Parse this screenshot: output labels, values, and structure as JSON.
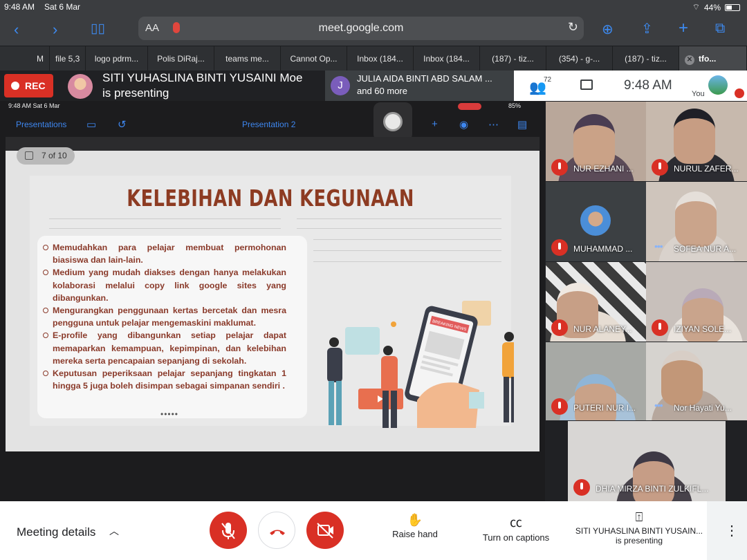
{
  "status_bar": {
    "time": "9:48 AM",
    "date": "Sat 6 Mar",
    "battery": "44%"
  },
  "browser": {
    "text_size_label": "AA",
    "url": "meet.google.com",
    "tabs": [
      {
        "label": "M"
      },
      {
        "label": "file 5,3"
      },
      {
        "label": "logo pdrm..."
      },
      {
        "label": "Polis DiRaj..."
      },
      {
        "label": "teams me..."
      },
      {
        "label": "Cannot Op..."
      },
      {
        "label": "Inbox (184..."
      },
      {
        "label": "Inbox (184..."
      },
      {
        "label": "(187) - tiz..."
      },
      {
        "label": "(354) - g-..."
      },
      {
        "label": "(187) - tiz..."
      },
      {
        "label": "tfo..."
      }
    ]
  },
  "meet_header": {
    "rec_label": "REC",
    "presenter_name": "SITI YUHASLINA BINTI YUSAINI Moe",
    "presenter_status": "is presenting",
    "participant_card": {
      "initial": "J",
      "name": "JULIA AIDA BINTI ABD SALAM ...",
      "more": "and 60 more"
    },
    "people_count": "72",
    "clock": "9:48 AM",
    "you_label": "You"
  },
  "shared_screen": {
    "status_time": "9:48 AM  Sat 6 Mar",
    "battery": "85%",
    "nav_back": "Presentations",
    "doc_title": "Presentation 2",
    "page_indicator": "7 of 10",
    "slide_title": "KELEBIHAN DAN KEGUNAAN",
    "bullets": [
      "Memudahkan para pelajar membuat permohonan biasiswa dan lain-lain.",
      "Medium yang mudah diakses dengan hanya melakukan kolaborasi melalui copy link google sites yang dibangunkan.",
      "Mengurangkan penggunaan kertas bercetak dan mesra pengguna untuk pelajar mengemaskini maklumat.",
      "E-profile yang dibangunkan setiap pelajar dapat memaparkan kemampuan, kepimpinan, dan kelebihan mereka serta pencapaian sepanjang di sekolah.",
      "Keputusan peperiksaan pelajar sepanjang tingkatan 1 hingga 5 juga boleh disimpan sebagai simpanan sendiri ."
    ],
    "slide_dots": "•••••",
    "illustration_news": "BREAKING NEWS"
  },
  "participants": [
    {
      "name": "NUR EZHANI ...",
      "mic": "muted"
    },
    {
      "name": "NURUL ZAFER...",
      "mic": "muted"
    },
    {
      "name": "MUHAMMAD ...",
      "mic": "muted"
    },
    {
      "name": "SOFEA NUR A...",
      "mic": "speaking"
    },
    {
      "name": "NUR ALANEY...",
      "mic": "muted"
    },
    {
      "name": "IZIYAN SOLE...",
      "mic": "muted"
    },
    {
      "name": "PUTERI NUR I...",
      "mic": "muted"
    },
    {
      "name": "Nor Hayati Yu...",
      "mic": "speaking"
    },
    {
      "name": "DHIA MIRZA BINTI ZULKIFL...",
      "mic": "muted"
    }
  ],
  "bottom_bar": {
    "meeting_details": "Meeting details",
    "raise_hand": "Raise hand",
    "captions": "Turn on captions",
    "presenting_name": "SITI YUHASLINA BINTI YUSAIN...",
    "presenting_status": "is presenting"
  },
  "colors": {
    "rec_red": "#d93025",
    "ios_blue": "#3d8bf2",
    "slide_text": "#8a3a2a"
  }
}
